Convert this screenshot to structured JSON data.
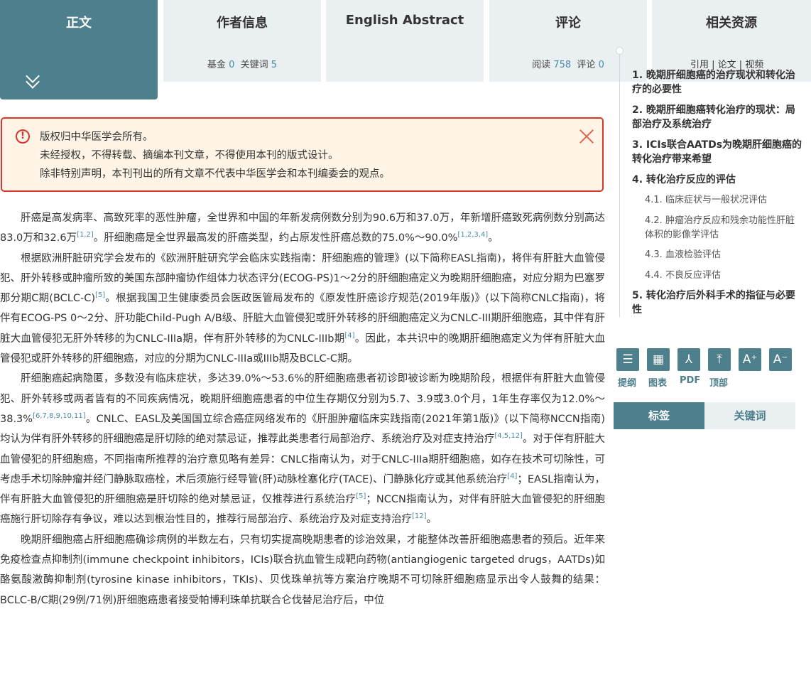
{
  "tabs": {
    "main": "正文",
    "author": "作者信息",
    "abstract": "English Abstract",
    "comments": "评论",
    "resources": "相关资源",
    "author_sub_prefix": "基金",
    "author_fund_count": "0",
    "author_sub_kw": "关键词",
    "author_kw_count": "5",
    "comments_sub_read": "阅读",
    "comments_read_count": "758",
    "comments_sub_comment": "评论",
    "comments_comment_count": "0",
    "resources_sub": "引用 | 论文 | 视频"
  },
  "notice": {
    "line1": "版权归中华医学会所有。",
    "line2": "未经授权，不得转载、摘编本刊文章，不得使用本刊的版式设计。",
    "line3": "除非特别声明，本刊刊出的所有文章不代表中华医学会和本刊编委会的观点。"
  },
  "article": {
    "p1_a": "肝癌是高发病率、高致死率的恶性肿瘤，全世界和中国的年新发病例数分别为90.6万和37.0万，年新增肝癌致死病例数分别高达83.0万和32.6万",
    "p1_ref1": "[1,2]",
    "p1_b": "。肝细胞癌是全世界最高发的肝癌类型，约占原发性肝癌总数的75.0%～90.0%",
    "p1_ref2": "[1,2,3,4]",
    "p1_c": "。",
    "p2_a": "根据欧洲肝脏研究学会发布的《欧洲肝脏研究学会临床实践指南：肝细胞癌的管理》(以下简称EASL指南)，将伴有肝脏大血管侵犯、肝外转移或肿瘤所致的美国东部肿瘤协作组体力状态评分(ECOG-PS)1～2分的肝细胞癌定义为晚期肝细胞癌，对应分期为巴塞罗那分期C期(BCLC-C)",
    "p2_ref1": "[5]",
    "p2_b": "。根据我国卫生健康委员会医政医管局发布的《原发性肝癌诊疗规范(2019年版)》(以下简称CNLC指南)，将伴有ECOG-PS 0～2分、肝功能Child-Pugh A/B级、肝脏大血管侵犯或肝外转移的肝细胞癌定义为CNLC-III期肝细胞癌，其中伴有肝脏大血管侵犯无肝外转移的为CNLC-IIIa期，伴有肝外转移的为CNLC-IIIb期",
    "p2_ref2": "[4]",
    "p2_c": "。因此，本共识中的晚期肝细胞癌定义为伴有肝脏大血管侵犯或肝外转移的肝细胞癌，对应的分期为CNLC-IIIa或IIIb期及BCLC-C期。",
    "p3_a": "肝细胞癌起病隐匿，多数没有临床症状，多达39.0%～53.6%的肝细胞癌患者初诊即被诊断为晚期阶段，根据伴有肝脏大血管侵犯、肝外转移或两者皆有的不同疾病情况，晚期肝细胞癌患者的中位生存期仅分别为5.7、3.9或3.0个月，1年生存率仅为12.0%～38.3%",
    "p3_ref1": "[6,7,8,9,10,11]",
    "p3_b": "。CNLC、EASL及美国国立综合癌症网络发布的《肝胆肿瘤临床实践指南(2021年第1版)》(以下简称NCCN指南)均认为伴有肝外转移的肝细胞癌是肝切除的绝对禁忌证，推荐此类患者行局部治疗、系统治疗及对症支持治疗",
    "p3_ref2": "[4,5,12]",
    "p3_c": "。对于伴有肝脏大血管侵犯的肝细胞癌，不同指南所推荐的治疗意见略有差异：CNLC指南认为，对于CNLC-IIIa期肝细胞癌，如存在技术可切除性，可考虑手术切除肿瘤并经门静脉取癌栓，术后须施行经导管(肝)动脉栓塞化疗(TACE)、门静脉化疗或其他系统治疗",
    "p3_ref3": "[4]",
    "p3_d": "；EASL指南认为，伴有肝脏大血管侵犯的肝细胞癌是肝切除的绝对禁忌证，仅推荐进行系统治疗",
    "p3_ref4": "[5]",
    "p3_e": "；NCCN指南认为，对伴有肝脏大血管侵犯的肝细胞癌施行肝切除存有争议，难以达到根治性目的，推荐行局部治疗、系统治疗及对症支持治疗",
    "p3_ref5": "[12]",
    "p3_f": "。",
    "p4_a": "晚期肝细胞癌占肝细胞癌确诊病例的半数左右，只有切实提高晚期患者的诊治效果，才能整体改善肝细胞癌患者的预后。近年来免疫检查点抑制剂(immune checkpoint inhibitors，ICIs)联合抗血管生成靶向药物(antiangiogenic targeted drugs，AATDs)如酪氨酸激酶抑制剂(tyrosine kinase inhibitors，TKIs)、贝伐珠单抗等方案治疗晚期不可切除肝细胞癌显示出令人鼓舞的结果：BCLC-B/C期(29例/71例)肝细胞癌患者接受帕博利珠单抗联合仑伐替尼治疗后，中位"
  },
  "toc": {
    "items": [
      {
        "label": "1. 晚期肝细胞癌的治疗现状和转化治疗的必要性"
      },
      {
        "label": "2. 晚期肝细胞癌转化治疗的现状：局部治疗及系统治疗"
      },
      {
        "label": "3. ICIs联合AATDs为晚期肝细胞癌的转化治疗带来希望"
      },
      {
        "label": "4. 转化治疗反应的评估"
      },
      {
        "label": "4.1. 临床症状与一般状况评估"
      },
      {
        "label": "4.2. 肿瘤治疗反应和残余功能性肝脏体积的影像学评估"
      },
      {
        "label": "4.3. 血液检验评估"
      },
      {
        "label": "4.4. 不良反应评估"
      },
      {
        "label": "5. 转化治疗后外科手术的指征与必要性"
      }
    ]
  },
  "tools": {
    "outline": "提纲",
    "figures": "图表",
    "pdf": "PDF",
    "top": "顶部",
    "font_up": "A⁺",
    "font_down": "A⁻"
  },
  "tag_tabs": {
    "tags": "标签",
    "keywords": "关键词"
  },
  "colors": {
    "accent": "#4d7f8c",
    "link": "#4b8aa6",
    "notice_border": "#d9352b",
    "notice_bg": "#fff4e5"
  }
}
